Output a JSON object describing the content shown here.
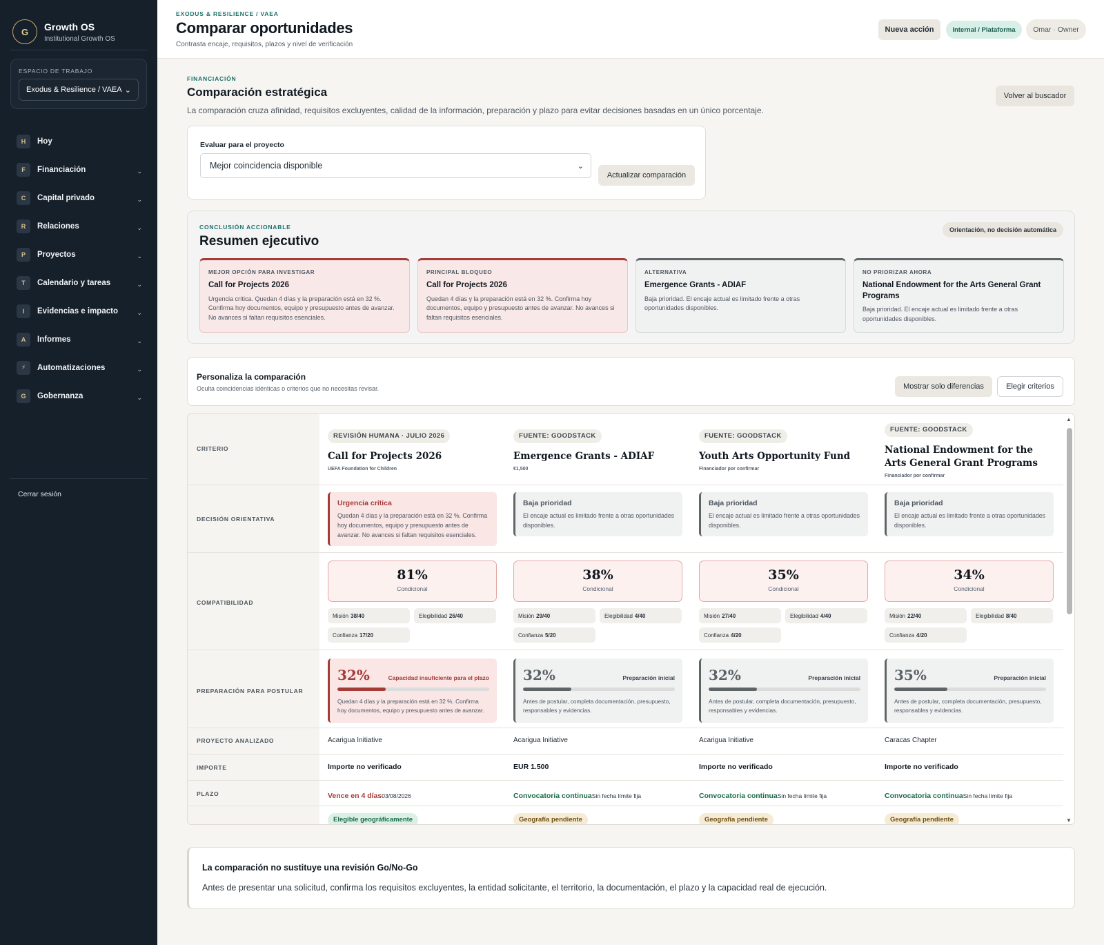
{
  "sidebar": {
    "brand_initial": "G",
    "brand_name": "Growth OS",
    "brand_sub": "Institutional Growth OS",
    "workspace_label": "ESPACIO DE TRABAJO",
    "workspace_value": "Exodus & Resilience / VAEA",
    "items": [
      {
        "badge": "H",
        "label": "Hoy",
        "expandable": false
      },
      {
        "badge": "F",
        "label": "Financiación",
        "expandable": true
      },
      {
        "badge": "C",
        "label": "Capital privado",
        "expandable": true
      },
      {
        "badge": "R",
        "label": "Relaciones",
        "expandable": true
      },
      {
        "badge": "P",
        "label": "Proyectos",
        "expandable": true
      },
      {
        "badge": "T",
        "label": "Calendario y tareas",
        "expandable": true
      },
      {
        "badge": "I",
        "label": "Evidencias e impacto",
        "expandable": true
      },
      {
        "badge": "A",
        "label": "Informes",
        "expandable": true
      },
      {
        "badge": "⚡",
        "label": "Automatizaciones",
        "expandable": true
      },
      {
        "badge": "G",
        "label": "Gobernanza",
        "expandable": true
      }
    ],
    "logout": "Cerrar sesión"
  },
  "header": {
    "breadcrumb": "EXODUS & RESILIENCE / VAEA",
    "title": "Comparar oportunidades",
    "subtitle": "Contrasta encaje, requisitos, plazos y nivel de verificación",
    "new_action": "Nueva acción",
    "scope": "Internal / Plataforma",
    "user": "Omar · Owner"
  },
  "section": {
    "eyebrow": "FINANCIACIÓN",
    "title": "Comparación estratégica",
    "description": "La comparación cruza afinidad, requisitos excluyentes, calidad de la información, preparación y plazo para evitar decisiones basadas en un único porcentaje.",
    "back_button": "Volver al buscador"
  },
  "evaluate": {
    "label": "Evaluar para el proyecto",
    "selected": "Mejor coincidencia disponible",
    "button": "Actualizar comparación"
  },
  "summary": {
    "eyebrow": "CONCLUSIÓN ACCIONABLE",
    "title": "Resumen ejecutivo",
    "pill": "Orientación, no decisión automática",
    "cards": [
      {
        "eyebrow": "MEJOR OPCIÓN PARA INVESTIGAR",
        "title": "Call for Projects 2026",
        "text": "Urgencia crítica. Quedan 4 días y la preparación está en 32 %. Confirma hoy documentos, equipo y presupuesto antes de avanzar. No avances si faltan requisitos esenciales.",
        "tone": "red"
      },
      {
        "eyebrow": "PRINCIPAL BLOQUEO",
        "title": "Call for Projects 2026",
        "text": "Quedan 4 días y la preparación está en 32 %. Confirma hoy documentos, equipo y presupuesto antes de avanzar. No avances si faltan requisitos esenciales.",
        "tone": "red"
      },
      {
        "eyebrow": "ALTERNATIVA",
        "title": "Emergence Grants - ADIAF",
        "text": "Baja prioridad. El encaje actual es limitado frente a otras oportunidades disponibles.",
        "tone": "gray"
      },
      {
        "eyebrow": "NO PRIORIZAR AHORA",
        "title": "National Endowment for the Arts General Grant Programs",
        "text": "Baja prioridad. El encaje actual es limitado frente a otras oportunidades disponibles.",
        "tone": "gray"
      }
    ]
  },
  "personalize": {
    "title": "Personaliza la comparación",
    "subtitle": "Oculta coincidencias idénticas o criterios que no necesitas revisar.",
    "diff_button": "Mostrar solo diferencias",
    "criteria_button": "Elegir criterios"
  },
  "comparison": {
    "row_labels": {
      "criterio": "CRITERIO",
      "decision": "DECISIÓN ORIENTATIVA",
      "compat": "COMPATIBILIDAD",
      "prep": "PREPARACIÓN PARA POSTULAR",
      "project": "PROYECTO ANALIZADO",
      "amount": "IMPORTE",
      "deadline": "PLAZO"
    },
    "columns": [
      {
        "source": "REVISIÓN HUMANA · JULIO 2026",
        "title": "Call for Projects 2026",
        "subtitle": "UEFA Foundation for Children",
        "decision_title": "Urgencia crítica",
        "decision_text": "Quedan 4 días y la preparación está en 32 %. Confirma hoy documentos, equipo y presupuesto antes de avanzar. No avances si faltan requisitos esenciales.",
        "decision_tone": "red",
        "compat_pct": "81%",
        "compat_label": "Condicional",
        "mision_label": "Misión",
        "mision": "38/40",
        "eleg_label": "Elegibilidad",
        "eleg": "26/40",
        "conf_label": "Confianza",
        "conf": "17/20",
        "prep_pct": "32%",
        "prep_value": 0.32,
        "prep_status": "Capacidad insuficiente para el plazo",
        "prep_text": "Quedan 4 días y la preparación está en 32 %. Confirma hoy documentos, equipo y presupuesto antes de avanzar.",
        "prep_tone": "red",
        "project": "Acarigua Initiative",
        "amount": "Importe no verificado",
        "deadline": "Vence en 4 días",
        "deadline_sub": "03/08/2026",
        "deadline_tone": "red",
        "geo": "Elegible geográficamente",
        "geo_tone": "ok"
      },
      {
        "source": "FUENTE: GOODSTACK",
        "title": "Emergence Grants - ADIAF",
        "subtitle": "€1,500",
        "decision_title": "Baja prioridad",
        "decision_text": "El encaje actual es limitado frente a otras oportunidades disponibles.",
        "decision_tone": "gray",
        "compat_pct": "38%",
        "compat_label": "Condicional",
        "mision_label": "Misión",
        "mision": "29/40",
        "eleg_label": "Elegibilidad",
        "eleg": "4/40",
        "conf_label": "Confianza",
        "conf": "5/20",
        "prep_pct": "32%",
        "prep_value": 0.32,
        "prep_status": "Preparación inicial",
        "prep_text": "Antes de postular, completa documentación, presupuesto, responsables y evidencias.",
        "prep_tone": "gray",
        "project": "Acarigua Initiative",
        "amount": "EUR 1.500",
        "deadline": "Convocatoria continua",
        "deadline_sub": "Sin fecha límite fija",
        "deadline_tone": "green",
        "geo": "Geografía pendiente",
        "geo_tone": "pend"
      },
      {
        "source": "FUENTE: GOODSTACK",
        "title": "Youth Arts Opportunity Fund",
        "subtitle": "Financiador por confirmar",
        "decision_title": "Baja prioridad",
        "decision_text": "El encaje actual es limitado frente a otras oportunidades disponibles.",
        "decision_tone": "gray",
        "compat_pct": "35%",
        "compat_label": "Condicional",
        "mision_label": "Misión",
        "mision": "27/40",
        "eleg_label": "Elegibilidad",
        "eleg": "4/40",
        "conf_label": "Confianza",
        "conf": "4/20",
        "prep_pct": "32%",
        "prep_value": 0.32,
        "prep_status": "Preparación inicial",
        "prep_text": "Antes de postular, completa documentación, presupuesto, responsables y evidencias.",
        "prep_tone": "gray",
        "project": "Acarigua Initiative",
        "amount": "Importe no verificado",
        "deadline": "Convocatoria continua",
        "deadline_sub": "Sin fecha límite fija",
        "deadline_tone": "green",
        "geo": "Geografía pendiente",
        "geo_tone": "pend"
      },
      {
        "source": "FUENTE: GOODSTACK",
        "title": "National Endowment for the Arts General Grant Programs",
        "subtitle": "Financiador por confirmar",
        "decision_title": "Baja prioridad",
        "decision_text": "El encaje actual es limitado frente a otras oportunidades disponibles.",
        "decision_tone": "gray",
        "compat_pct": "34%",
        "compat_label": "Condicional",
        "mision_label": "Misión",
        "mision": "22/40",
        "eleg_label": "Elegibilidad",
        "eleg": "8/40",
        "conf_label": "Confianza",
        "conf": "4/20",
        "prep_pct": "35%",
        "prep_value": 0.35,
        "prep_status": "Preparación inicial",
        "prep_text": "Antes de postular, completa documentación, presupuesto, responsables y evidencias.",
        "prep_tone": "gray",
        "project": "Caracas Chapter",
        "amount": "Importe no verificado",
        "deadline": "Convocatoria continua",
        "deadline_sub": "Sin fecha límite fija",
        "deadline_tone": "green",
        "geo": "Geografía pendiente",
        "geo_tone": "pend"
      }
    ]
  },
  "note": {
    "title": "La comparación no sustituye una revisión Go/No-Go",
    "text": "Antes de presentar una solicitud, confirma los requisitos excluyentes, la entidad solicitante, el territorio, la documentación, el plazo y la capacidad real de ejecución."
  },
  "colors": {
    "sidebar_bg": "#16202b",
    "accent_teal": "#19716b",
    "danger": "#a33b37",
    "success": "#1a6b48"
  }
}
